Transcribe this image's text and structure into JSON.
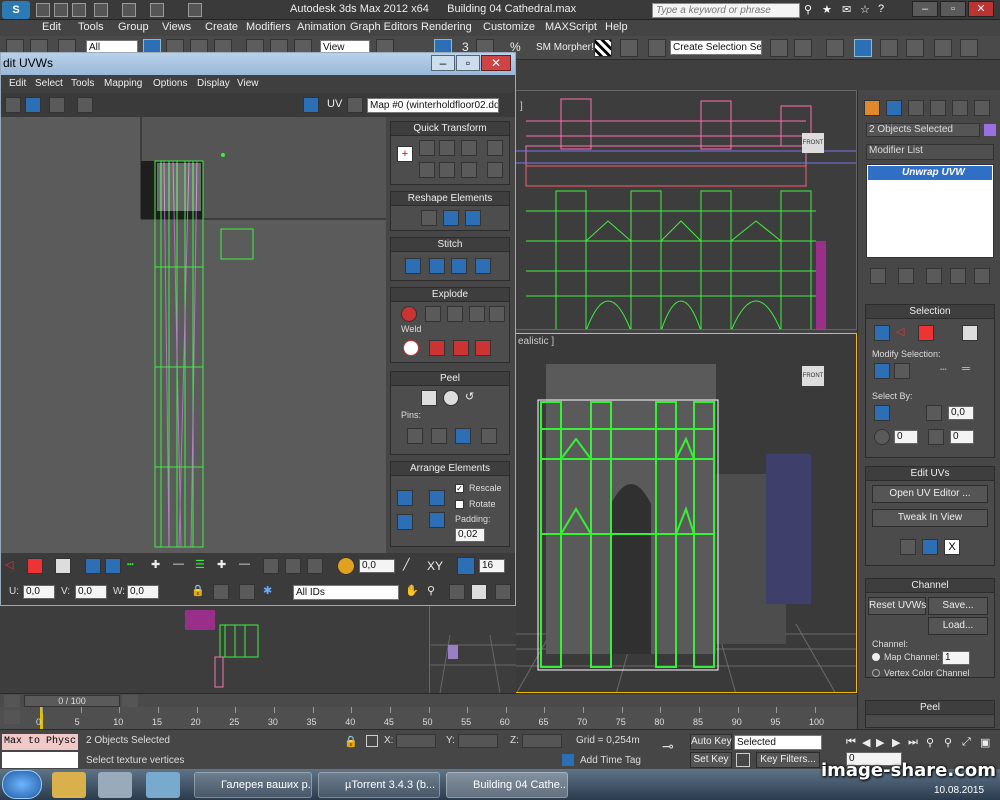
{
  "app": {
    "title": "Autodesk 3ds Max 2012 x64",
    "file": "Building 04 Cathedral.max",
    "search_placeholder": "Type a keyword or phrase"
  },
  "menu": [
    "Edit",
    "Tools",
    "Group",
    "Views",
    "Create",
    "Modifiers",
    "Animation",
    "Graph Editors",
    "Rendering",
    "Customize",
    "MAXScript",
    "Help"
  ],
  "toolbar": {
    "filter": "All",
    "view": "View",
    "num": "3",
    "morpher": "SM Morpher!",
    "selection_set": "Create Selection Se"
  },
  "uvw": {
    "title": "dit UVWs",
    "menu": [
      "Edit",
      "Select",
      "Tools",
      "Mapping",
      "Options",
      "Display",
      "View"
    ],
    "uv_label": "UV",
    "map": "Map #0 (winterholdfloor02.dds",
    "quick_transform": "Quick Transform",
    "reshape": "Reshape Elements",
    "stitch": "Stitch",
    "explode": "Explode",
    "weld": "Weld",
    "peel": "Peel",
    "pins": "Pins:",
    "arrange": "Arrange Elements",
    "rescale": "Rescale",
    "rotate": "Rotate",
    "padding_label": "Padding:",
    "padding": "0,02",
    "soft_value": "0,0",
    "xy": "XY",
    "grid_num": "16",
    "u_label": "U:",
    "u": "0,0",
    "v_label": "V:",
    "v": "0,0",
    "w_label": "W:",
    "w": "0,0",
    "ids": "All IDs"
  },
  "viewports": {
    "top_label": "]",
    "top_cube": "FRONT",
    "persp_label": "ealistic ]",
    "persp_cube": "FRONT"
  },
  "command": {
    "selected": "2 Objects Selected",
    "modifier_list": "Modifier List",
    "modifier": "Unwrap UVW",
    "selection_head": "Selection",
    "modify_selection": "Modify Selection:",
    "select_by": "Select By:",
    "sel_val1": "0,0",
    "sel_val2": "0",
    "sel_val3": "0",
    "edit_uvs": "Edit UVs",
    "open_uv_editor": "Open UV Editor ...",
    "tweak": "Tweak In View",
    "channel_head": "Channel",
    "reset": "Reset UVWs",
    "save": "Save...",
    "load": "Load...",
    "channel": "Channel:",
    "map_channel": "Map Channel:",
    "map_channel_val": "1",
    "vertex_color": "Vertex Color Channel",
    "peel_head": "Peel"
  },
  "timeline": {
    "frame": "0 / 100",
    "ticks": [
      "0",
      "5",
      "10",
      "15",
      "20",
      "25",
      "30",
      "35",
      "40",
      "45",
      "50",
      "55",
      "60",
      "65",
      "70",
      "75",
      "80",
      "85",
      "90",
      "95",
      "100"
    ]
  },
  "status": {
    "script": "Max to Physc",
    "selected": "2 Objects Selected",
    "prompt": "Select texture vertices",
    "x": "X:",
    "y": "Y:",
    "z": "Z:",
    "grid": "Grid = 0,254m",
    "add_time_tag": "Add Time Tag",
    "auto_key": "Auto Key",
    "set_key": "Set Key",
    "selected_dd": "Selected",
    "key_filters": "Key Filters...",
    "frame_val": "0"
  },
  "taskbar": {
    "t1": "Галерея ваших р...",
    "t2": "µTorrent 3.4.3  (b...",
    "t3": "Building 04 Cathe...",
    "date": "10.08.2015"
  },
  "watermark": "image-share.com"
}
